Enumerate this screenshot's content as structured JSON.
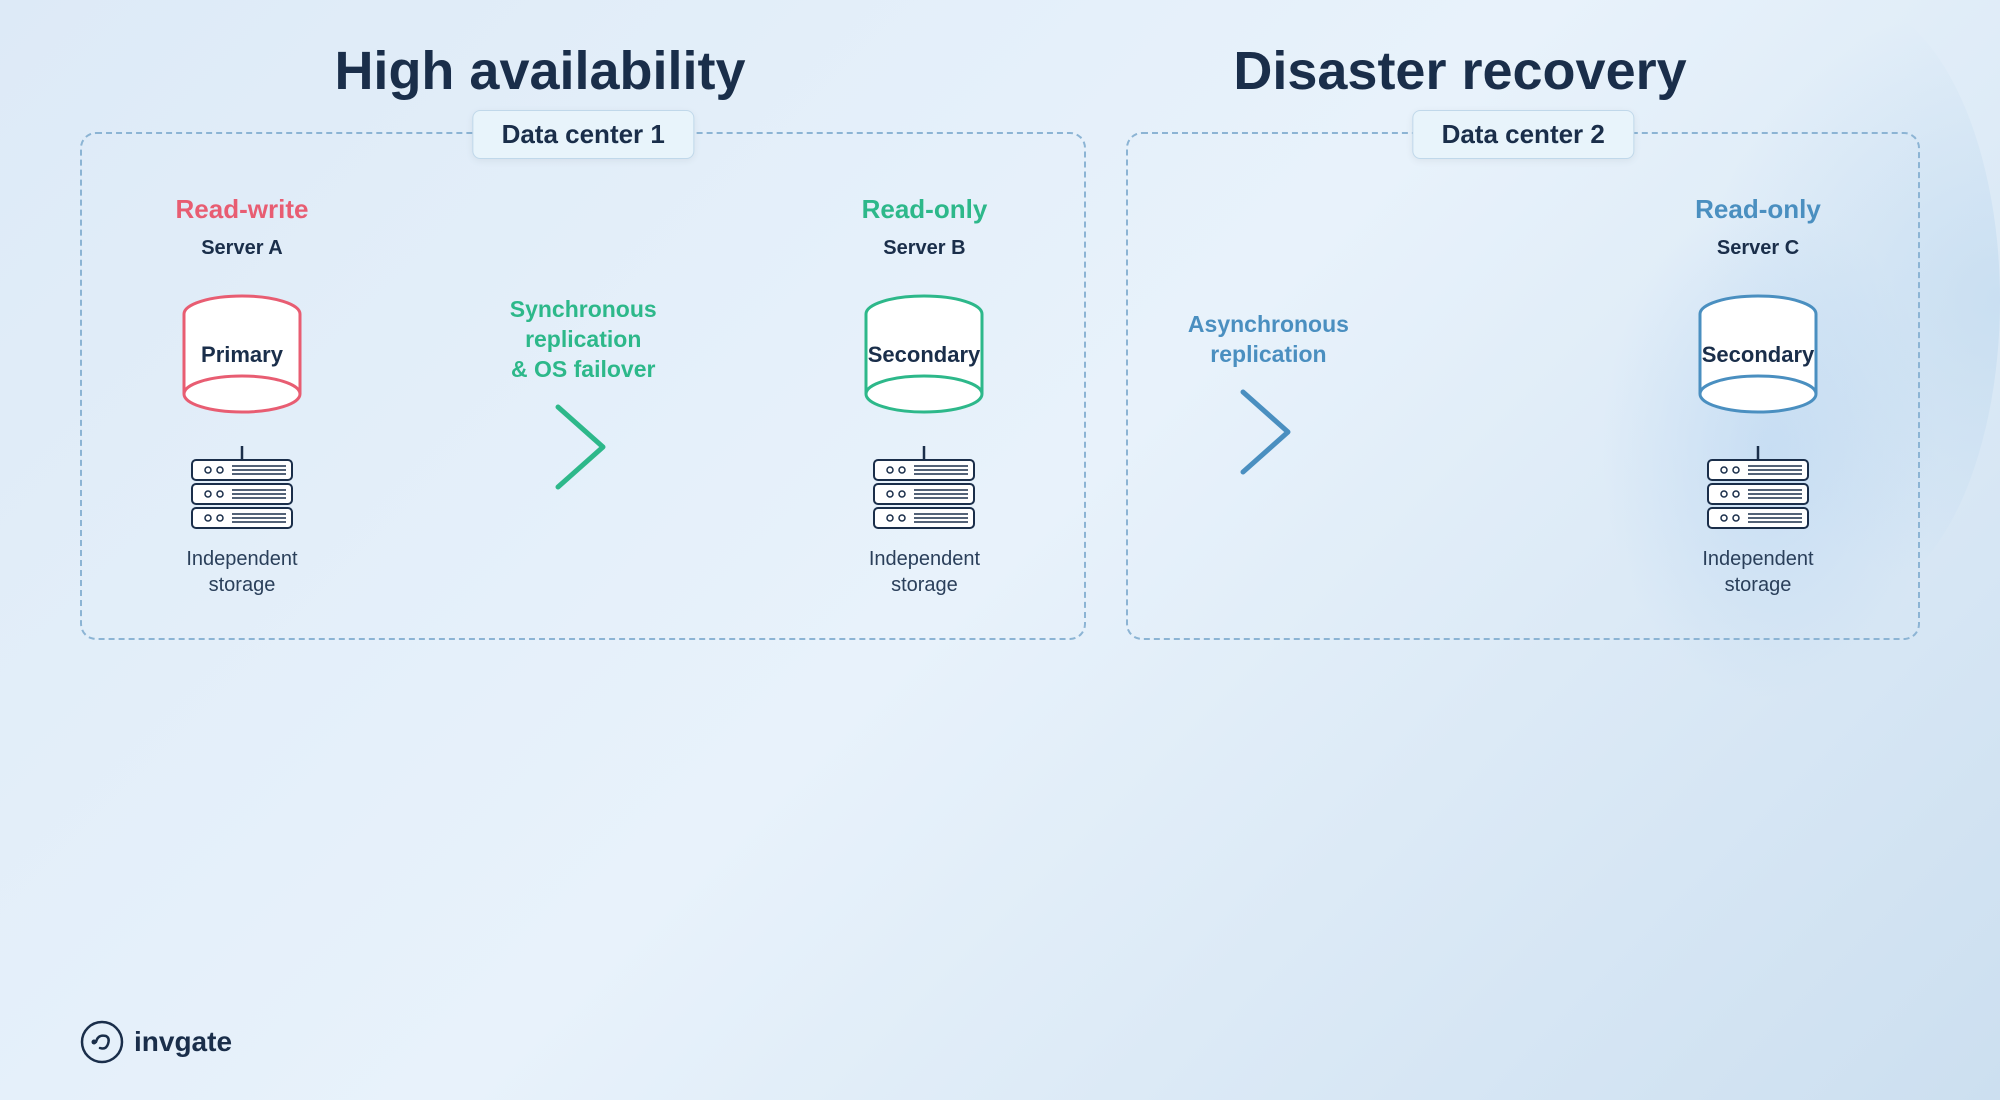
{
  "page": {
    "background_gradient": "linear-gradient(135deg, #ddeaf7 0%, #e8f2fb 50%, #ccdff0 100%)"
  },
  "titles": {
    "high_availability": "High availability",
    "disaster_recovery": "Disaster recovery"
  },
  "datacenter1": {
    "label": "Data center 1",
    "server_a": {
      "mode": "Read-write",
      "mode_color": "red",
      "name": "Server A",
      "db_label": "Primary",
      "db_color": "#e85d72",
      "storage_label": "Independent\nstorage"
    },
    "replication": {
      "text": "Synchronous\nreplication\n& OS failover",
      "color": "green"
    },
    "server_b": {
      "mode": "Read-only",
      "mode_color": "green",
      "name": "Server B",
      "db_label": "Secondary",
      "db_color": "#2db88a",
      "storage_label": "Independent\nstorage"
    }
  },
  "datacenter2": {
    "label": "Data center 2",
    "replication": {
      "text": "Asynchronous\nreplication",
      "color": "blue"
    },
    "server_c": {
      "mode": "Read-only",
      "mode_color": "blue",
      "name": "Server C",
      "db_label": "Secondary",
      "db_color": "#4a8fc0",
      "storage_label": "Independent\nstorage"
    }
  },
  "logo": {
    "text": "invgate"
  }
}
